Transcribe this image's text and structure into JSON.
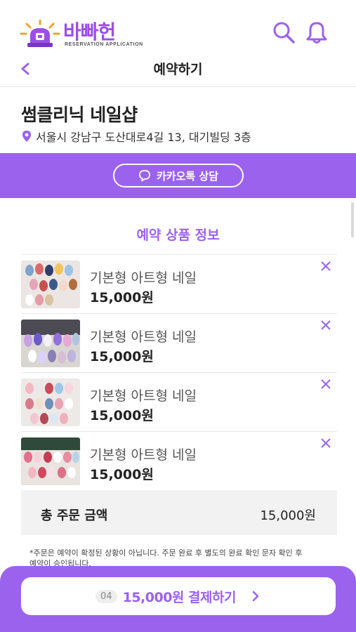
{
  "app": {
    "logo_text": "바빠헌",
    "logo_sub": "RESERVATION APPLICATION"
  },
  "header": {
    "title": "예약하기"
  },
  "shop": {
    "name": "썸클리닉  네일샵",
    "address": "서울시 강남구 도산대로4길 13, 대기빌딩 3층"
  },
  "kakao": {
    "label": "카카오톡 상담"
  },
  "section": {
    "title": "예약 상품 정보"
  },
  "products": [
    {
      "name": "기본형 아트형 네일",
      "price": "15,000원"
    },
    {
      "name": "기본형 아트형 네일",
      "price": "15,000원"
    },
    {
      "name": "기본형 아트형 네일",
      "price": "15,000원"
    },
    {
      "name": "기본형 아트형 네일",
      "price": "15,000원"
    }
  ],
  "total": {
    "label": "총 주문 금액",
    "value": "15,000원"
  },
  "notice": "*주문은 예약이 확정된 상황이 아닙니다. 주문 완료 후 별도의 완료 확인 문자 확인 후 예약이 승인됩니다.",
  "pay": {
    "count": "04",
    "label": "15,000원 결제하기"
  },
  "colors": {
    "accent": "#9b62ee",
    "logo": "#9b4fe6"
  }
}
